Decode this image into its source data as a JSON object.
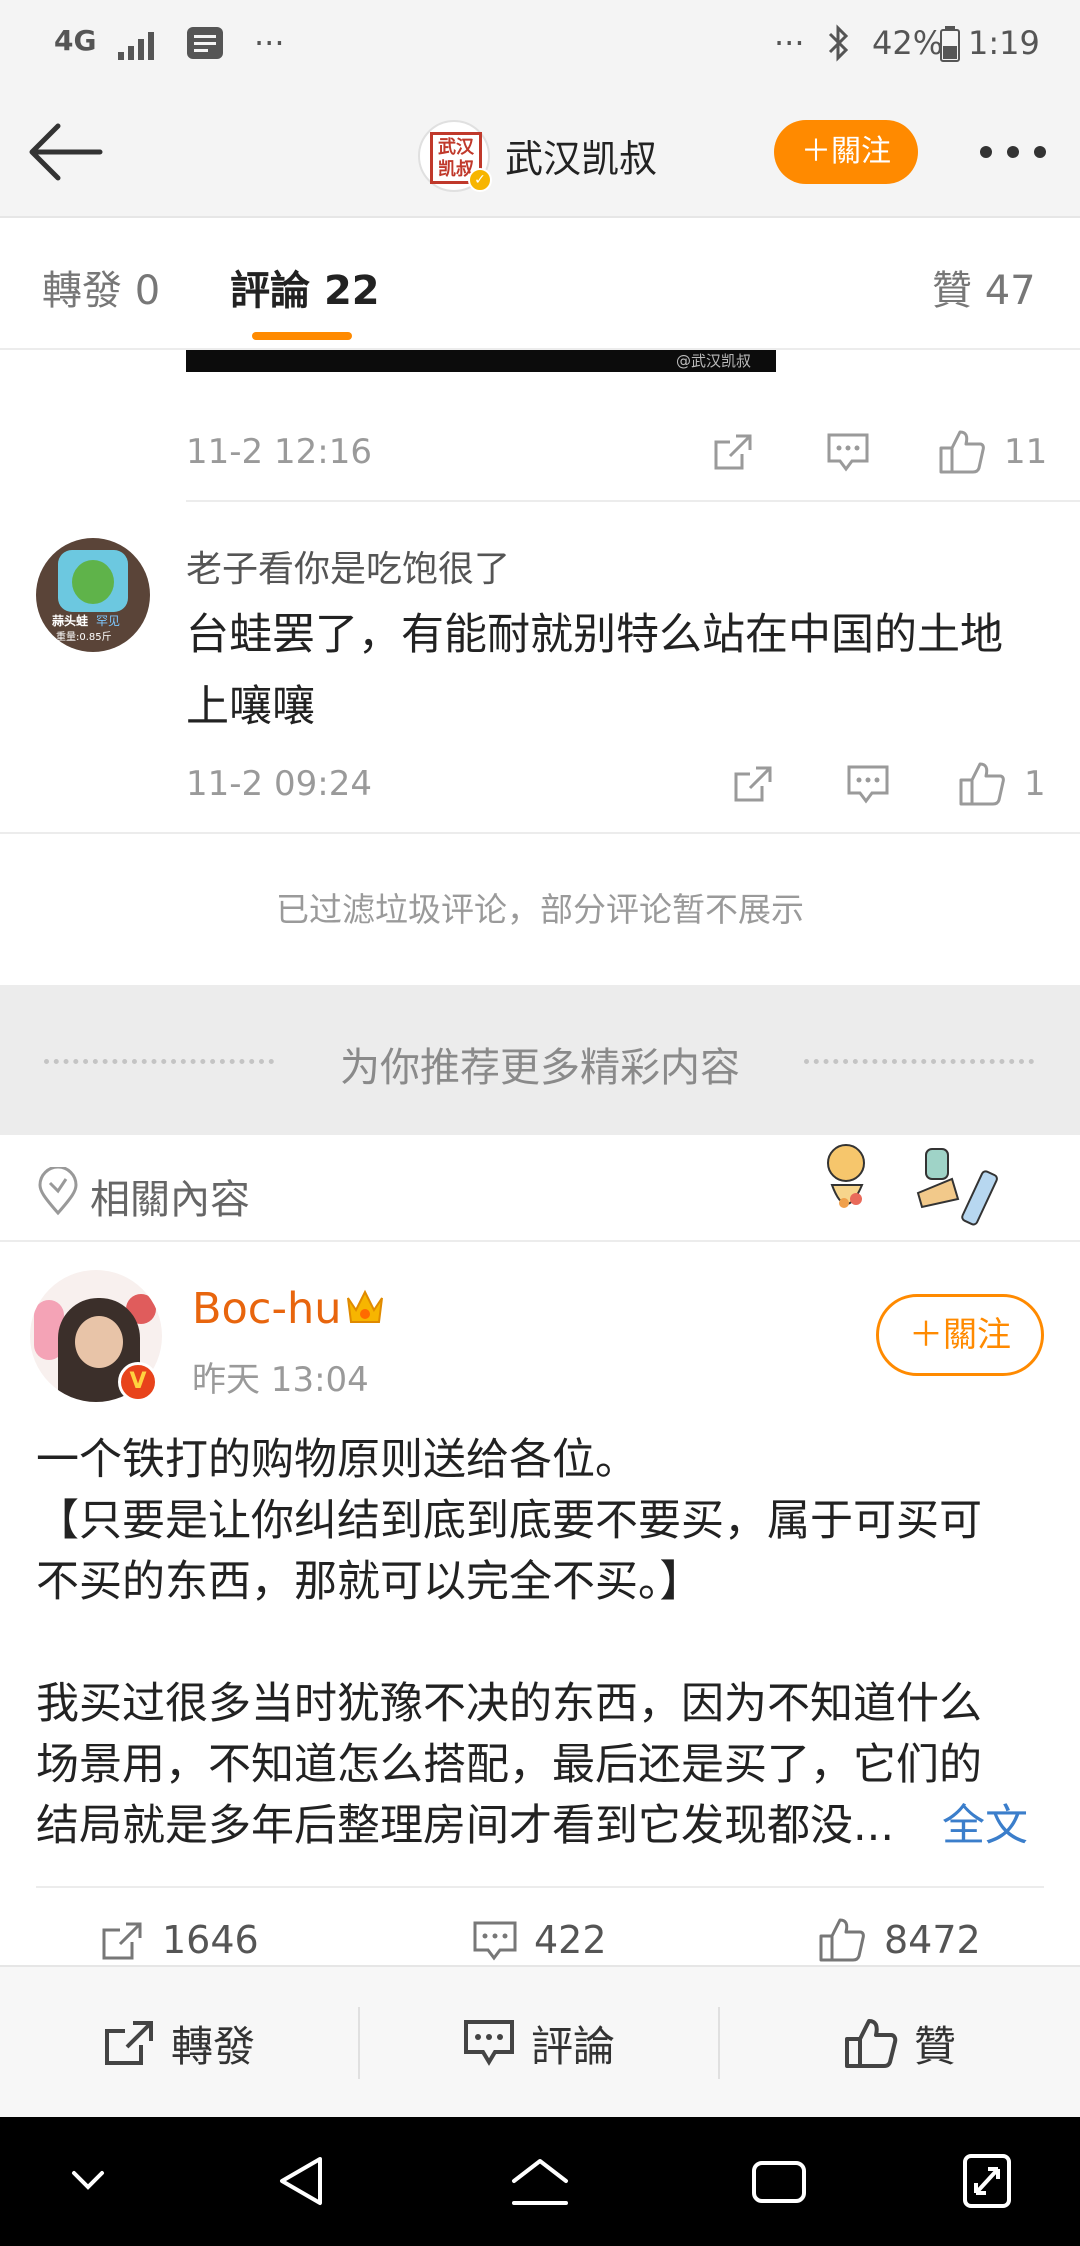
{
  "status_bar": {
    "network": "4G",
    "dots_left": "···",
    "dots_right": "···",
    "battery": "42%",
    "time": "1:19"
  },
  "header": {
    "logo_text": "武汉凯叔",
    "account_name": "武汉凯叔",
    "follow_label": "＋關注",
    "more_icon": "more-dots-icon"
  },
  "tabs": [
    {
      "label": "轉發",
      "count": "0"
    },
    {
      "label": "評論",
      "count": "22"
    },
    {
      "label": "贊",
      "count": "47"
    }
  ],
  "comments": [
    {
      "image_watermark": "@武汉凯叔",
      "time": "11-2 12:16",
      "likes": "11"
    },
    {
      "avatar_text": "蒜头蛙",
      "avatar_badge": "罕见",
      "avatar_weight": "重量:0.85斤",
      "username": "老子看你是吃饱很了",
      "line1": "台蛙罢了，有能耐就别特么站在中国的土地",
      "line2": "上嚷嚷",
      "time": "11-2 09:24",
      "likes": "1"
    }
  ],
  "filter_note": "已过滤垃圾评论，部分评论暂不展示",
  "recommend_text": "为你推荐更多精彩内容",
  "related_label": "相關內容",
  "post": {
    "author": "Boc-hu",
    "time": "昨天 13:04",
    "follow_label": "＋關注",
    "verified_badge": "V",
    "lines": [
      "一个铁打的购物原则送给各位。",
      "【只要是让你纠结到底到底要不要买，属于可买可",
      "不买的东西，那就可以完全不买。】",
      "我买过很多当时犹豫不决的东西，因为不知道什么",
      "场景用，不知道怎么搭配，最后还是买了，它们的",
      "结局就是多年后整理房间才看到它发现都没..."
    ],
    "full_text_link": "全文",
    "reposts": "1646",
    "comments": "422",
    "likes": "8472"
  },
  "action_bar": {
    "repost_label": "轉發",
    "comment_label": "評論",
    "like_label": "贊"
  },
  "colors": {
    "accent": "#ff8a00",
    "link": "#3b7ecb",
    "author": "#e8650d"
  }
}
